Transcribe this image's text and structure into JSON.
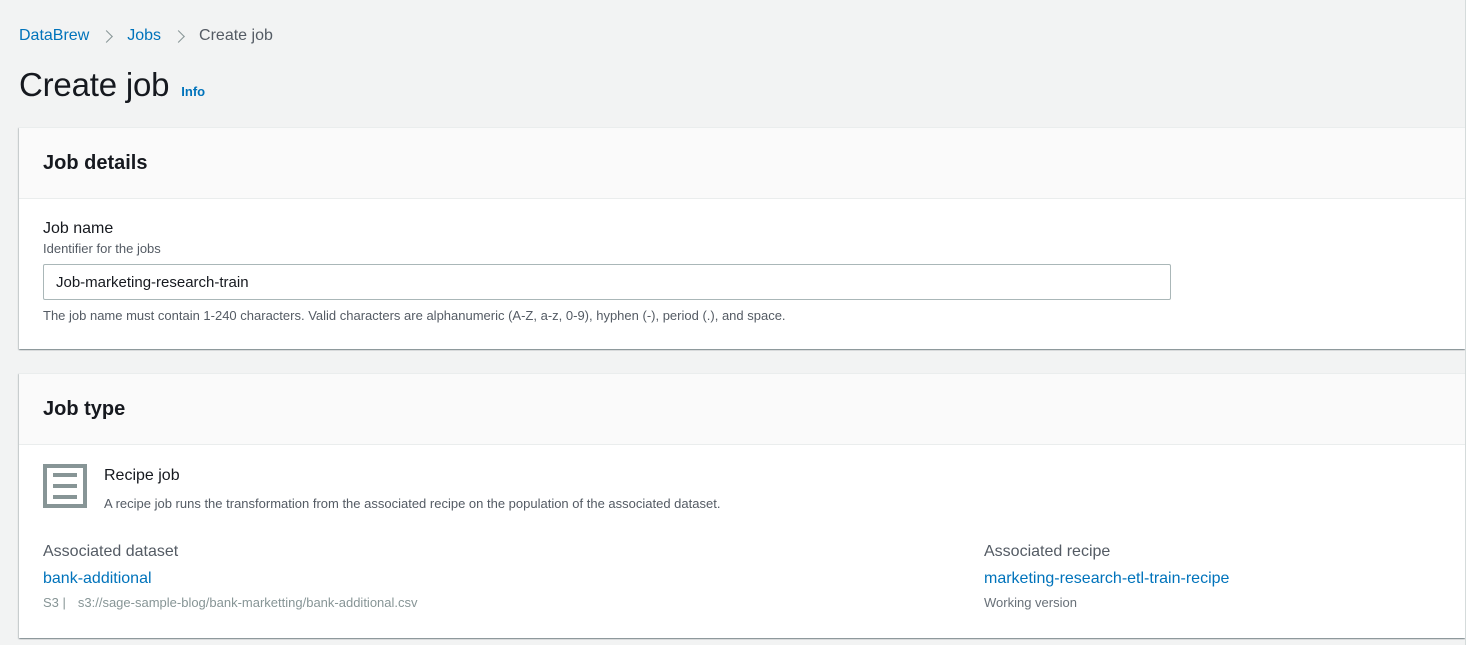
{
  "breadcrumb": {
    "items": [
      "DataBrew",
      "Jobs"
    ],
    "current": "Create job"
  },
  "page": {
    "title": "Create job",
    "info_label": "Info"
  },
  "job_details": {
    "title": "Job details",
    "job_name_label": "Job name",
    "job_name_desc": "Identifier for the jobs",
    "job_name_value": "Job-marketing-research-train",
    "job_name_constraint": "The job name must contain 1-240 characters. Valid characters are alphanumeric (A-Z, a-z, 0-9), hyphen (-), period (.), and space."
  },
  "job_type": {
    "title": "Job type",
    "recipe_job_title": "Recipe job",
    "recipe_job_desc": "A recipe job runs the transformation from the associated recipe on the population of the associated dataset.",
    "icon": "recipe-list-icon",
    "dataset": {
      "label": "Associated dataset",
      "name": "bank-additional",
      "source_tag": "S3 |",
      "path": "s3://sage-sample-blog/bank-marketting/bank-additional.csv"
    },
    "recipe": {
      "label": "Associated recipe",
      "name": "marketing-research-etl-train-recipe",
      "version": "Working version"
    }
  },
  "colors": {
    "link": "#0073bb",
    "background": "#f2f3f3",
    "text": "#16191f",
    "muted": "#545b64"
  }
}
